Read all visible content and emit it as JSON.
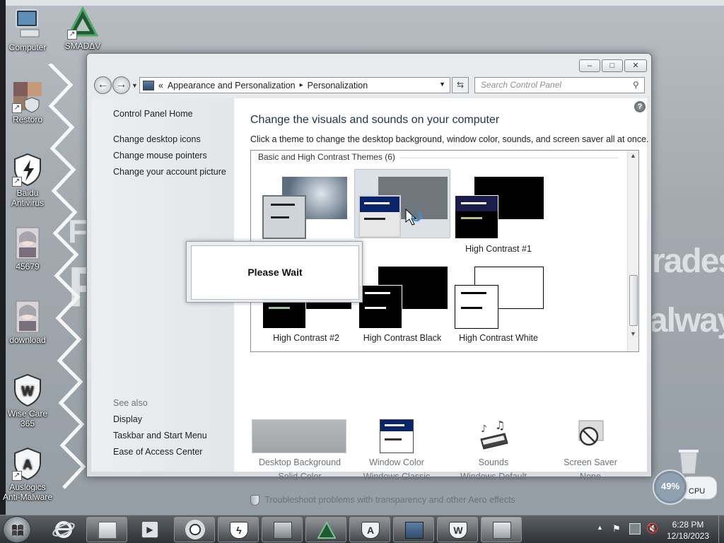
{
  "desktop": {
    "wallpaper_text": [
      "FO",
      "F",
      "rades,",
      "always"
    ],
    "icons": [
      {
        "label": "Computer"
      },
      {
        "label": "SMADΔV"
      },
      {
        "label": "Restoro"
      },
      {
        "label": "Baidu Antivirus"
      },
      {
        "label": "45679"
      },
      {
        "label": "download"
      },
      {
        "label": "Wise Care 365"
      },
      {
        "label": "Auslogics Anti-Malware"
      }
    ]
  },
  "window": {
    "caption": {
      "minimize": "‒",
      "maximize": "□",
      "close": "✕"
    },
    "address": {
      "chevrons": "«",
      "crumb1": "Appearance and Personalization",
      "separator": "▸",
      "crumb2": "Personalization"
    },
    "search": {
      "placeholder": "Search Control Panel"
    },
    "left_pane": {
      "home": "Control Panel Home",
      "links": [
        "Change desktop icons",
        "Change mouse pointers",
        "Change your account picture"
      ],
      "see_also_heading": "See also",
      "see_also": [
        "Display",
        "Taskbar and Start Menu",
        "Ease of Access Center"
      ]
    },
    "main": {
      "heading": "Change the visuals and sounds on your computer",
      "subheading": "Click a theme to change the desktop background, window color, sounds, and screen saver all at once.",
      "group_label": "Basic and High Contrast Themes (6)",
      "themes": [
        {
          "label": ""
        },
        {
          "label": ""
        },
        {
          "label": "High Contrast #1"
        },
        {
          "label": "High Contrast #2"
        },
        {
          "label": "High Contrast Black"
        },
        {
          "label": "High Contrast White"
        }
      ],
      "bottom": [
        {
          "title": "Desktop Background",
          "value": "Solid Color"
        },
        {
          "title": "Window Color",
          "value": "Windows Classic"
        },
        {
          "title": "Sounds",
          "value": "Windows Default"
        },
        {
          "title": "Screen Saver",
          "value": "None"
        }
      ],
      "troubleshoot": "Troubleshoot problems with transparency and other Aero effects",
      "help": "?"
    },
    "dialog": {
      "text": "Please Wait"
    }
  },
  "gadget": {
    "percent": "49%",
    "label": "CPU",
    "value": 49
  },
  "taskbar": {
    "apps": [
      "Internet Explorer",
      "File Explorer",
      "Media Player",
      "Chrome",
      "Baidu Antivirus",
      "Photos",
      "SMADAV",
      "Auslogics",
      "Control Panel",
      "Wise Care 365",
      "Personalization"
    ],
    "time": "6:28 PM",
    "date": "12/18/2023"
  },
  "colors": {
    "hc_black": "#000000",
    "hc_selected": "#3a3a8e",
    "aero_accent": "#3e8fd3"
  }
}
